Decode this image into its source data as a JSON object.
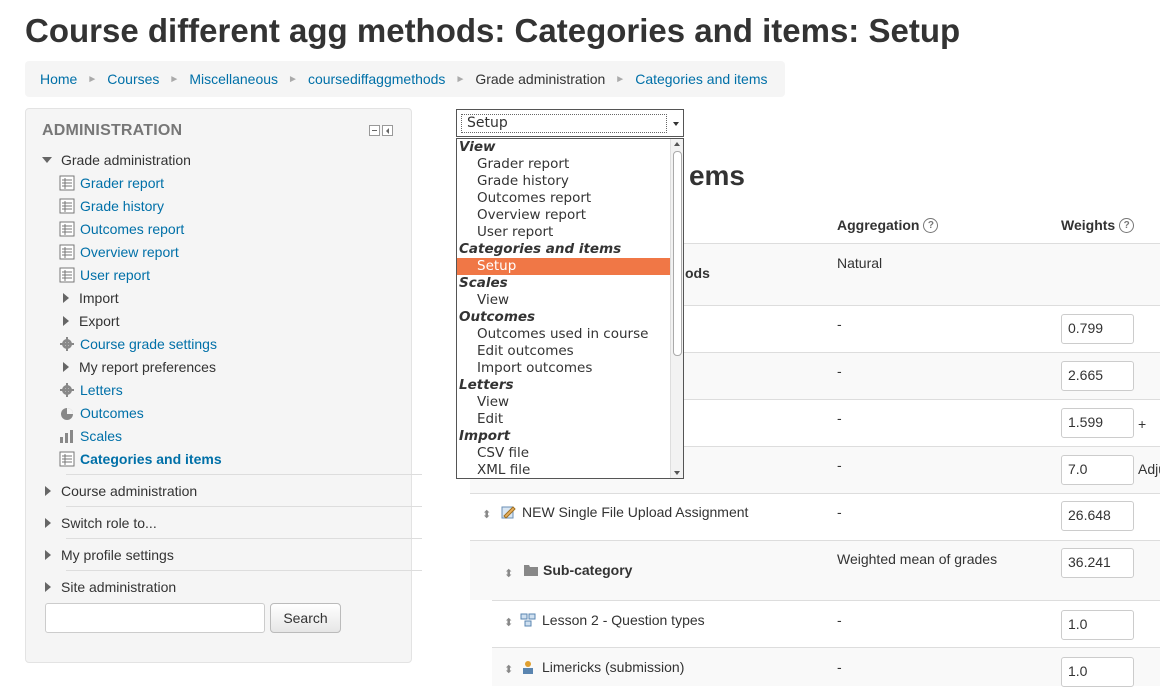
{
  "page_title": "Course different agg methods: Categories and items: Setup",
  "breadcrumb": [
    {
      "label": "Home"
    },
    {
      "label": "Courses"
    },
    {
      "label": "Miscellaneous"
    },
    {
      "label": "coursediffaggmethods"
    },
    {
      "label": "Grade administration"
    },
    {
      "label": "Categories and items"
    }
  ],
  "admin": {
    "header": "ADMINISTRATION",
    "grade_admin": "Grade administration",
    "items": [
      {
        "label": "Grader report",
        "icon": "report-icon"
      },
      {
        "label": "Grade history",
        "icon": "report-icon"
      },
      {
        "label": "Outcomes report",
        "icon": "report-icon"
      },
      {
        "label": "Overview report",
        "icon": "report-icon"
      },
      {
        "label": "User report",
        "icon": "report-icon"
      },
      {
        "label": "Import",
        "icon": "caret-right"
      },
      {
        "label": "Export",
        "icon": "caret-right"
      },
      {
        "label": "Course grade settings",
        "icon": "gear-icon"
      },
      {
        "label": "My report preferences",
        "icon": "caret-right"
      },
      {
        "label": "Letters",
        "icon": "gear-icon"
      },
      {
        "label": "Outcomes",
        "icon": "outcomes-icon"
      },
      {
        "label": "Scales",
        "icon": "scales-icon"
      },
      {
        "label": "Categories and items",
        "icon": "report-icon"
      }
    ],
    "sections": [
      "Course administration",
      "Switch role to...",
      "My profile settings",
      "Site administration"
    ],
    "search_button": "Search",
    "search_value": ""
  },
  "select": {
    "value": "Setup",
    "groups": [
      {
        "label": "View",
        "options": [
          "Grader report",
          "Grade history",
          "Outcomes report",
          "Overview report",
          "User report"
        ]
      },
      {
        "label": "Categories and items",
        "options": [
          "Setup"
        ]
      },
      {
        "label": "Scales",
        "options": [
          "View"
        ]
      },
      {
        "label": "Outcomes",
        "options": [
          "Outcomes used in course",
          "Edit outcomes",
          "Import outcomes"
        ]
      },
      {
        "label": "Letters",
        "options": [
          "View",
          "Edit"
        ]
      },
      {
        "label": "Import",
        "options": [
          "CSV file",
          "XML file"
        ]
      }
    ]
  },
  "content": {
    "heading_visible": "ems",
    "columns": {
      "aggregation": "Aggregation",
      "weights": "Weights"
    },
    "top_category_suffix": "ods",
    "top_aggregation": "Natural",
    "rows": [
      {
        "name": "",
        "aggregation": "-",
        "weight": "0.799",
        "extra": ""
      },
      {
        "name": "",
        "aggregation": "-",
        "weight": "2.665",
        "extra": ""
      },
      {
        "name": "",
        "aggregation": "-",
        "weight": "1.599",
        "extra": "+"
      },
      {
        "name": "",
        "aggregation": "-",
        "weight": "7.0",
        "extra": "Adju"
      },
      {
        "name": "NEW Single File Upload Assignment",
        "aggregation": "-",
        "weight": "26.648",
        "extra": ""
      },
      {
        "name": "Sub-category",
        "aggregation": "Weighted mean of grades",
        "weight": "36.241",
        "extra": ""
      },
      {
        "name": "Lesson 2 - Question types",
        "aggregation": "-",
        "weight": "1.0",
        "extra": ""
      },
      {
        "name": "Limericks (submission)",
        "aggregation": "-",
        "weight": "1.0",
        "extra": ""
      }
    ]
  },
  "colors": {
    "link": "#0070a8",
    "selected_option": "#f07746"
  }
}
